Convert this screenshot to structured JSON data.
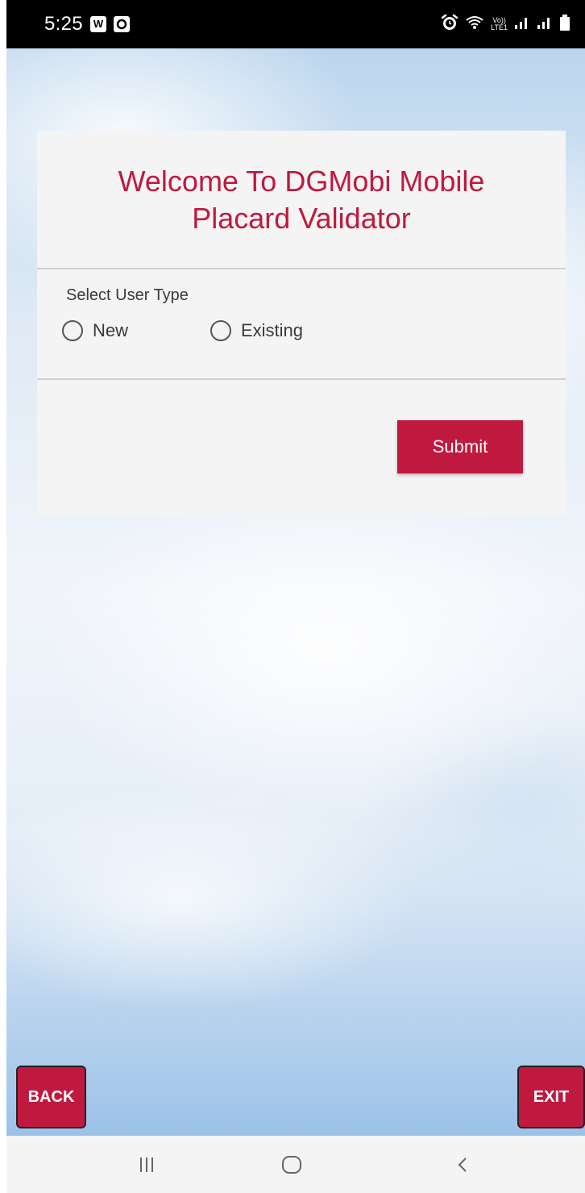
{
  "status_bar": {
    "time": "5:25",
    "left_icons": [
      "w-app-icon",
      "camera-app-icon"
    ],
    "right_icons": [
      "alarm-icon",
      "wifi-icon",
      "volte-icon",
      "signal-icon",
      "signal-icon-2",
      "battery-icon"
    ],
    "volte_text_top": "Vo))",
    "volte_text_bottom": "LTE1"
  },
  "card": {
    "title_line1": "Welcome To DGMobi Mobile",
    "title_line2": "Placard Validator",
    "select_label": "Select User Type",
    "radio_options": [
      {
        "label": "New",
        "selected": false
      },
      {
        "label": "Existing",
        "selected": false
      }
    ],
    "submit_label": "Submit"
  },
  "buttons": {
    "back_label": "BACK",
    "exit_label": "EXIT"
  },
  "nav_bar": {
    "items": [
      "recent-apps-icon",
      "home-icon",
      "back-nav-icon"
    ]
  },
  "colors": {
    "accent": "#c0193f",
    "card_background": "#f4f4f4",
    "status_bar": "#000000"
  }
}
